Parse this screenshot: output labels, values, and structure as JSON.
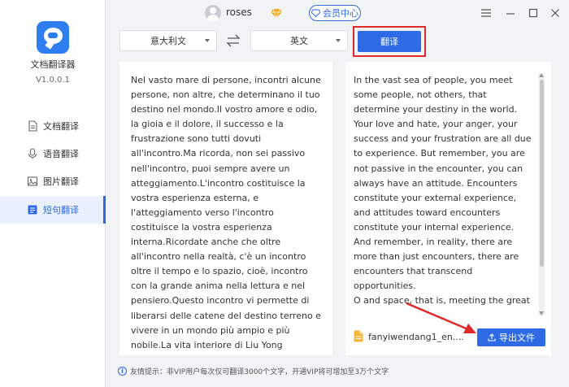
{
  "app": {
    "name": "文档翻译器",
    "version": "V1.0.0.1"
  },
  "user": {
    "name": "roses"
  },
  "titlebar": {
    "vip_center": "会员中心"
  },
  "sidebar": {
    "items": [
      {
        "label": "文档翻译",
        "icon": "document-icon"
      },
      {
        "label": "语音翻译",
        "icon": "microphone-icon"
      },
      {
        "label": "图片翻译",
        "icon": "image-icon"
      },
      {
        "label": "短句翻译",
        "icon": "sentence-icon",
        "active": true
      }
    ]
  },
  "toolbar": {
    "source_lang": "意大利文",
    "target_lang": "英文",
    "translate_label": "翻译"
  },
  "source_text": "Nel vasto mare di persone, incontri alcune persone, non altre, che determinano il tuo destino nel mondo.Il vostro amore e odio, la gioia e il dolore, il successo e la frustrazione sono tutti dovuti all'incontro.Ma ricorda, non sei passivo nell'incontro, puoi sempre avere un atteggiamento.L'incontro costituisce la vostra esperienza esterna, e l'atteggiamento verso l'incontro costituisce la vostra esperienza interna.Ricordate anche che oltre all'incontro nella realtà, c'è un incontro oltre il tempo e lo spazio, cioè, incontro con la grande anima nella lettura e nel pensiero.Questo incontro vi permette di liberarsi delle catene del destino terreno e vivere in un mondo più ampio e più nobile.La vita interiore di Liu Yong",
  "target_text": "In the vast sea of people, you meet some people, not others, that determine your destiny in the world. Your love and hate, your anger, your success and your frustration are all due to experience. But remember, you are not passive in the encounter, you can always have an attitude. Encounters constitute your external experience, and attitudes toward encounters constitute your internal experience. And remember, in reality, there are more than just encounters, there are encounters that transcend opportunities.\nO and space, that is, meeting the great soul in reading and thinking. This encounter has freed you from the bondage of earthly destiny and made you live in a broader and nobler world.\nLiu Yong's Inner Life",
  "output": {
    "file_name": "fanyiwendang1_en....",
    "export_label": "导出文件"
  },
  "footer": {
    "tip": "友情提示：非VIP用户每次仅可翻译3000个文字，开通VIP将可增加至3万个文字"
  },
  "colors": {
    "accent": "#2d6ae3",
    "highlight": "#e02a2a"
  }
}
